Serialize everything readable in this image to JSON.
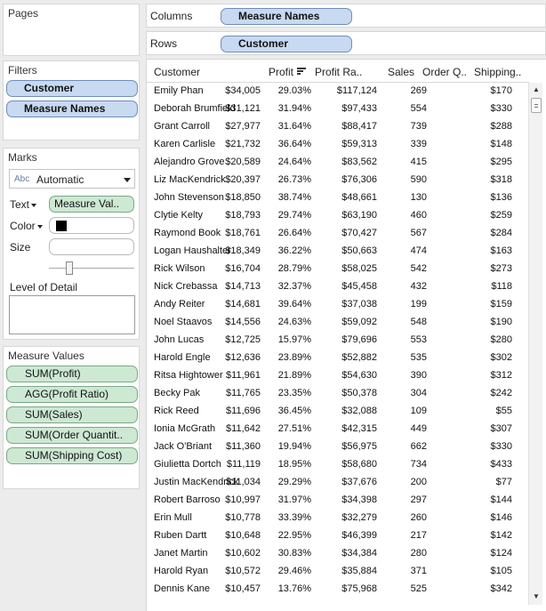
{
  "shelves": {
    "pages_title": "Pages",
    "columns_label": "Columns",
    "columns_pill": "Measure Names",
    "rows_label": "Rows",
    "rows_pill": "Customer"
  },
  "filters": {
    "title": "Filters",
    "items": [
      "Customer",
      "Measure Names"
    ]
  },
  "marks": {
    "title": "Marks",
    "type_icon": "Abc",
    "type_value": "Automatic",
    "text_label": "Text",
    "text_pill": "Measure Val..",
    "color_label": "Color",
    "color_swatch": "#000000",
    "size_label": "Size",
    "lod_label": "Level of Detail"
  },
  "measure_values": {
    "title": "Measure Values",
    "items": [
      "SUM(Profit)",
      "AGG(Profit Ratio)",
      "SUM(Sales)",
      "SUM(Order Quantit..",
      "SUM(Shipping Cost)"
    ]
  },
  "table": {
    "headers": [
      "Customer",
      "Profit",
      "Profit Ra..",
      "Sales",
      "Order Q..",
      "Shipping.."
    ],
    "rows": [
      [
        "Emily Phan",
        "$34,005",
        "29.03%",
        "$117,124",
        "269",
        "$170"
      ],
      [
        "Deborah Brumfield",
        "$31,121",
        "31.94%",
        "$97,433",
        "554",
        "$330"
      ],
      [
        "Grant Carroll",
        "$27,977",
        "31.64%",
        "$88,417",
        "739",
        "$288"
      ],
      [
        "Karen Carlisle",
        "$21,732",
        "36.64%",
        "$59,313",
        "339",
        "$148"
      ],
      [
        "Alejandro Grove",
        "$20,589",
        "24.64%",
        "$83,562",
        "415",
        "$295"
      ],
      [
        "Liz MacKendrick",
        "$20,397",
        "26.73%",
        "$76,306",
        "590",
        "$318"
      ],
      [
        "John Stevenson",
        "$18,850",
        "38.74%",
        "$48,661",
        "130",
        "$136"
      ],
      [
        "Clytie Kelty",
        "$18,793",
        "29.74%",
        "$63,190",
        "460",
        "$259"
      ],
      [
        "Raymond Book",
        "$18,761",
        "26.64%",
        "$70,427",
        "567",
        "$284"
      ],
      [
        "Logan Haushalter",
        "$18,349",
        "36.22%",
        "$50,663",
        "474",
        "$163"
      ],
      [
        "Rick Wilson",
        "$16,704",
        "28.79%",
        "$58,025",
        "542",
        "$273"
      ],
      [
        "Nick Crebassa",
        "$14,713",
        "32.37%",
        "$45,458",
        "432",
        "$118"
      ],
      [
        "Andy Reiter",
        "$14,681",
        "39.64%",
        "$37,038",
        "199",
        "$159"
      ],
      [
        "Noel Staavos",
        "$14,556",
        "24.63%",
        "$59,092",
        "548",
        "$190"
      ],
      [
        "John Lucas",
        "$12,725",
        "15.97%",
        "$79,696",
        "553",
        "$280"
      ],
      [
        "Harold Engle",
        "$12,636",
        "23.89%",
        "$52,882",
        "535",
        "$302"
      ],
      [
        "Ritsa Hightower",
        "$11,961",
        "21.89%",
        "$54,630",
        "390",
        "$312"
      ],
      [
        "Becky Pak",
        "$11,765",
        "23.35%",
        "$50,378",
        "304",
        "$242"
      ],
      [
        "Rick Reed",
        "$11,696",
        "36.45%",
        "$32,088",
        "109",
        "$55"
      ],
      [
        "Ionia McGrath",
        "$11,642",
        "27.51%",
        "$42,315",
        "449",
        "$307"
      ],
      [
        "Jack O'Briant",
        "$11,360",
        "19.94%",
        "$56,975",
        "662",
        "$330"
      ],
      [
        "Giulietta Dortch",
        "$11,119",
        "18.95%",
        "$58,680",
        "734",
        "$433"
      ],
      [
        "Justin MacKendrick",
        "$11,034",
        "29.29%",
        "$37,676",
        "200",
        "$77"
      ],
      [
        "Robert Barroso",
        "$10,997",
        "31.97%",
        "$34,398",
        "297",
        "$144"
      ],
      [
        "Erin Mull",
        "$10,778",
        "33.39%",
        "$32,279",
        "260",
        "$146"
      ],
      [
        "Ruben Dartt",
        "$10,648",
        "22.95%",
        "$46,399",
        "217",
        "$142"
      ],
      [
        "Janet Martin",
        "$10,602",
        "30.83%",
        "$34,384",
        "280",
        "$124"
      ],
      [
        "Harold Ryan",
        "$10,572",
        "29.46%",
        "$35,884",
        "371",
        "$105"
      ],
      [
        "Dennis Kane",
        "$10,457",
        "13.76%",
        "$75,968",
        "525",
        "$342"
      ]
    ]
  }
}
